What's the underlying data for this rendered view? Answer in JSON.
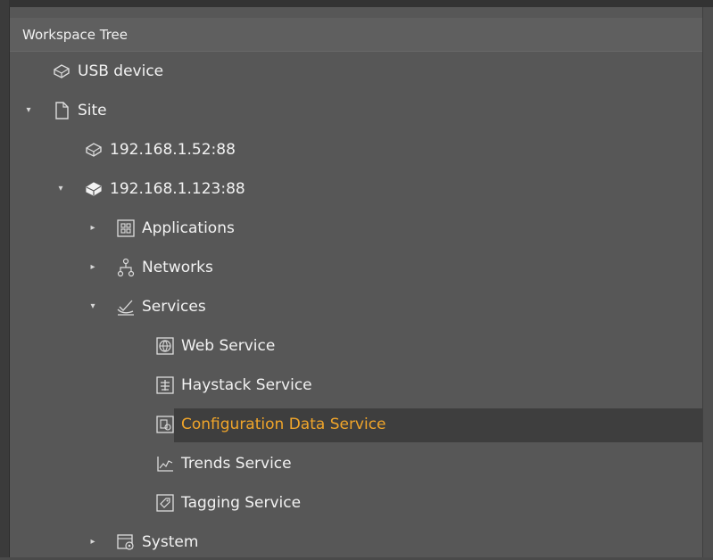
{
  "panel": {
    "title": "Workspace Tree"
  },
  "colors": {
    "background": "#575757",
    "selection": "#3e3e3e",
    "active_text": "#f0a52a"
  },
  "tree": [
    {
      "label": "USB device",
      "icon": "device-icon",
      "expanded": null
    },
    {
      "label": "Site",
      "icon": "site-document-icon",
      "expanded": true
    },
    {
      "label": "192.168.1.52:88",
      "icon": "device-icon",
      "expanded": null
    },
    {
      "label": "192.168.1.123:88",
      "icon": "device-filled-icon",
      "expanded": true
    },
    {
      "label": "Applications",
      "icon": "applications-icon",
      "expanded": false
    },
    {
      "label": "Networks",
      "icon": "networks-icon",
      "expanded": false
    },
    {
      "label": "Services",
      "icon": "services-icon",
      "expanded": true
    },
    {
      "label": "Web Service",
      "icon": "web-service-icon",
      "expanded": null
    },
    {
      "label": "Haystack Service",
      "icon": "haystack-service-icon",
      "expanded": null
    },
    {
      "label": "Configuration Data Service",
      "icon": "configuration-data-service-icon",
      "expanded": null,
      "selected": true
    },
    {
      "label": "Trends Service",
      "icon": "trends-service-icon",
      "expanded": null
    },
    {
      "label": "Tagging Service",
      "icon": "tagging-service-icon",
      "expanded": null
    },
    {
      "label": "System",
      "icon": "system-icon",
      "expanded": false
    }
  ]
}
